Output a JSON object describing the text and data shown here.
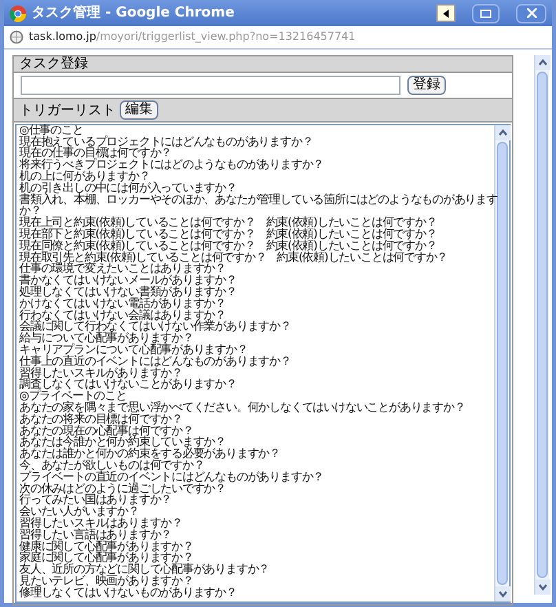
{
  "window": {
    "title": "タスク管理 - Google Chrome"
  },
  "address": {
    "host": "task.lomo.jp",
    "path": "/moyori/triggerlist_view.php?no=13216457741"
  },
  "task_form": {
    "header": "タスク登録",
    "button": "登録"
  },
  "trigger": {
    "label": "トリガーリスト",
    "button": "編集"
  },
  "lines": [
    "◎仕事のこと",
    "現在抱えているプロジェクトにはどんなものがありますか？",
    "現在の仕事の目標は何ですか？",
    "将来行うべきプロジェクトにはどのようなものがありますか？",
    "机の上に何がありますか？",
    "机の引き出しの中には何が入っていますか？",
    "書類入れ、本棚、ロッカーやそのほか、あなたが管理している箇所にはどのようなものがあります",
    "か？",
    "現在上司と約束(依頼)していることは何ですか？　約束(依頼)したいことは何ですか？",
    "現在部下と約束(依頼)していることは何ですか？　約束(依頼)したいことは何ですか？",
    "現在同僚と約束(依頼)していることは何ですか？　約束(依頼)したいことは何ですか？",
    "現在取引先と約束(依頼)していることは何ですか？　約束(依頼)したいことは何ですか？",
    "仕事の環境で変えたいことはありますか？",
    "書かなくてはいけないメールがありますか？",
    "処理しなくてはいけない書類がありますか？",
    "かけなくてはいけない電話がありますか？",
    "行わなくてはいけない会議はありますか？",
    "会議に関して行わなくてはいけない作業がありますか？",
    "給与について心配事がありますか？",
    "キャリアプランについて心配事がありますか？",
    "仕事上の直近のイベントにはどんなものがありますか？",
    "習得したいスキルがありますか？",
    "調査しなくてはいけないことがありますか？",
    "◎プライベートのこと",
    "あなたの家を隅々まで思い浮かべてください。何かしなくてはいけないことがありますか？",
    "あなたの将来の目標は何ですか？",
    "あなたの現在の心配事は何ですか？",
    "あなたは今誰かと何か約束していますか？",
    "あなたは誰かと何かの約束をする必要がありますか？",
    "今、あなたが欲しいものは何ですか？",
    "プライベートの直近のイベントにはどんなものがありますか？",
    "次の休みはどのように過ごしたいですか？",
    "行ってみたい国はありますか？",
    "会いたい人がいますか？",
    "習得したいスキルはありますか？",
    "習得したい言語はありますか？",
    "健康に関して心配事がありますか？",
    "家庭に関して心配事がありますか？",
    "友人、近所の方などに関して心配事がありますか？",
    "見たいテレビ、映画がありますか？",
    "修理しなくてはいけないものがありますか？"
  ]
}
